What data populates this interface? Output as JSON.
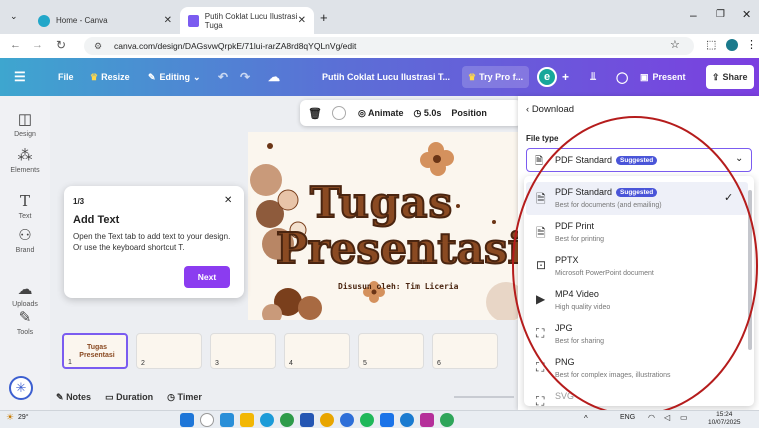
{
  "browser": {
    "tabs": [
      {
        "label": "Home - Canva"
      },
      {
        "label": "Putih Coklat Lucu Ilustrasi Tuga"
      }
    ],
    "url": "canva.com/design/DAGsvwQrpkE/71lui-rarZA8rd8qYQLnVg/edit"
  },
  "toolbar": {
    "file": "File",
    "resize": "Resize",
    "editing": "Editing",
    "title": "Putih Coklat Lucu Ilustrasi T...",
    "try_pro": "Try Pro f...",
    "avatar": "e",
    "present": "Present",
    "share": "Share"
  },
  "sidebar": {
    "items": [
      {
        "label": "Design"
      },
      {
        "label": "Elements"
      },
      {
        "label": "Text"
      },
      {
        "label": "Brand"
      },
      {
        "label": "Uploads"
      },
      {
        "label": "Tools"
      }
    ]
  },
  "floatbar": {
    "animate": "Animate",
    "duration": "5.0s",
    "position": "Position"
  },
  "slide": {
    "title_line1": "Tugas",
    "title_line2": "Presentasi",
    "author": "Disusun oleh: Tim Liceria"
  },
  "tip": {
    "step": "1/3",
    "title": "Add Text",
    "body": "Open the Text tab to add text to your design. Or use the keyboard shortcut T.",
    "next": "Next"
  },
  "thumbs": [
    {
      "n": "1"
    },
    {
      "n": "2"
    },
    {
      "n": "3"
    },
    {
      "n": "4"
    },
    {
      "n": "5"
    },
    {
      "n": "6"
    }
  ],
  "thumb1_text": "Tugas Presentasi",
  "bottom": {
    "notes": "Notes",
    "duration": "Duration",
    "timer": "Timer"
  },
  "download": {
    "header": "Download",
    "file_type_label": "File type",
    "selected": "PDF Standard",
    "suggested": "Suggested",
    "options": [
      {
        "title": "PDF Standard",
        "desc": "Best for documents (and emailing)",
        "badge": "Suggested",
        "icon": "document-icon"
      },
      {
        "title": "PDF Print",
        "desc": "Best for printing",
        "icon": "document-icon"
      },
      {
        "title": "PPTX",
        "desc": "Microsoft PowerPoint document",
        "icon": "presentation-icon"
      },
      {
        "title": "MP4 Video",
        "desc": "High quality video",
        "icon": "video-icon"
      },
      {
        "title": "JPG",
        "desc": "Best for sharing",
        "icon": "image-icon"
      },
      {
        "title": "PNG",
        "desc": "Best for complex images, illustrations",
        "icon": "image-icon"
      },
      {
        "title": "SVG",
        "desc": "",
        "icon": "image-icon"
      }
    ]
  },
  "taskbar": {
    "temp": "29°",
    "lang": "ENG",
    "time": "15:24",
    "date": "10/07/2025"
  },
  "colors": {
    "accent": "#7b5cf0",
    "annotation": "#b51c1c",
    "brown": "#8a4a22"
  }
}
